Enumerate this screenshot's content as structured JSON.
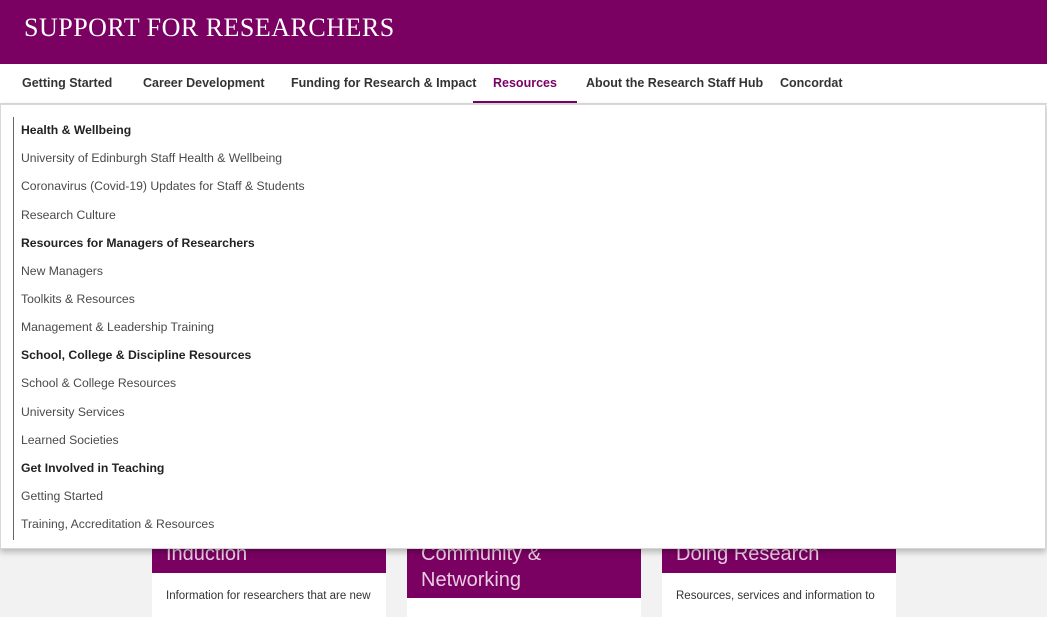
{
  "header": {
    "title": "SUPPORT FOR RESEARCHERS"
  },
  "nav": {
    "items": [
      {
        "label": "Getting Started"
      },
      {
        "label": "Career Development"
      },
      {
        "label": "Funding for Research & Impact"
      },
      {
        "label": "Resources",
        "active": true
      },
      {
        "label": "About the Research Staff Hub"
      },
      {
        "label": "Concordat"
      }
    ]
  },
  "dropdown": {
    "entries": [
      {
        "label": "Health & Wellbeing",
        "heading": true
      },
      {
        "label": "University of Edinburgh Staff Health & Wellbeing"
      },
      {
        "label": "Coronavirus (Covid-19) Updates for Staff & Students"
      },
      {
        "label": "Research Culture"
      },
      {
        "label": "Resources for Managers of Researchers",
        "heading": true
      },
      {
        "label": "New Managers"
      },
      {
        "label": "Toolkits & Resources"
      },
      {
        "label": "Management & Leadership Training"
      },
      {
        "label": "School, College & Discipline Resources",
        "heading": true
      },
      {
        "label": "School & College Resources"
      },
      {
        "label": "University Services"
      },
      {
        "label": "Learned Societies"
      },
      {
        "label": "Get Involved in Teaching",
        "heading": true
      },
      {
        "label": "Getting Started"
      },
      {
        "label": "Training, Accreditation & Resources"
      }
    ]
  },
  "cards": [
    {
      "title_line1": "Induction",
      "title_line2": "",
      "text": "Information for researchers that are new"
    },
    {
      "title_line1": "Community &",
      "title_line2": "Networking",
      "text": ""
    },
    {
      "title_line1": "Doing Research",
      "title_line2": "",
      "text": "Resources, services and information to"
    }
  ],
  "colors": {
    "brand": "#7a0062",
    "nav_active": "#7a0062"
  }
}
